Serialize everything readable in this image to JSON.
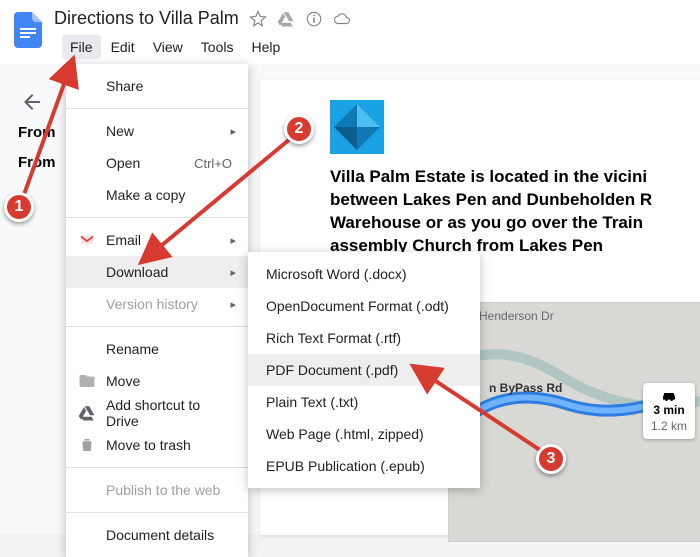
{
  "doc": {
    "title": "Directions to Villa Palm"
  },
  "menubar": {
    "file": "File",
    "edit": "Edit",
    "view": "View",
    "tools": "Tools",
    "help": "Help"
  },
  "leftstub": {
    "a": "From",
    "b": "From"
  },
  "fileMenu": {
    "share": "Share",
    "new": "New",
    "open": "Open",
    "open_shortcut": "Ctrl+O",
    "make_copy": "Make a copy",
    "email": "Email",
    "download": "Download",
    "version_history": "Version history",
    "rename": "Rename",
    "move": "Move",
    "add_shortcut": "Add shortcut to Drive",
    "trash": "Move to trash",
    "publish": "Publish to the web",
    "details": "Document details"
  },
  "downloadMenu": {
    "docx": "Microsoft Word (.docx)",
    "odt": "OpenDocument Format (.odt)",
    "rtf": "Rich Text Format (.rtf)",
    "pdf": "PDF Document (.pdf)",
    "txt": "Plain Text (.txt)",
    "html": "Web Page (.html, zipped)",
    "epub": "EPUB Publication (.epub)"
  },
  "body": {
    "line1": "Villa Palm Estate is located in the vicini",
    "line2": "between Lakes Pen and Dunbeholden R",
    "line3": "Warehouse or as you go over the Train",
    "line4": "assembly Church from Lakes Pen"
  },
  "map": {
    "street1": "Henderson Dr",
    "street2": "n ByPass Rd",
    "badge_time": "3 min",
    "badge_dist": "1.2 km"
  },
  "callouts": {
    "c1": "1",
    "c2": "2",
    "c3": "3"
  }
}
